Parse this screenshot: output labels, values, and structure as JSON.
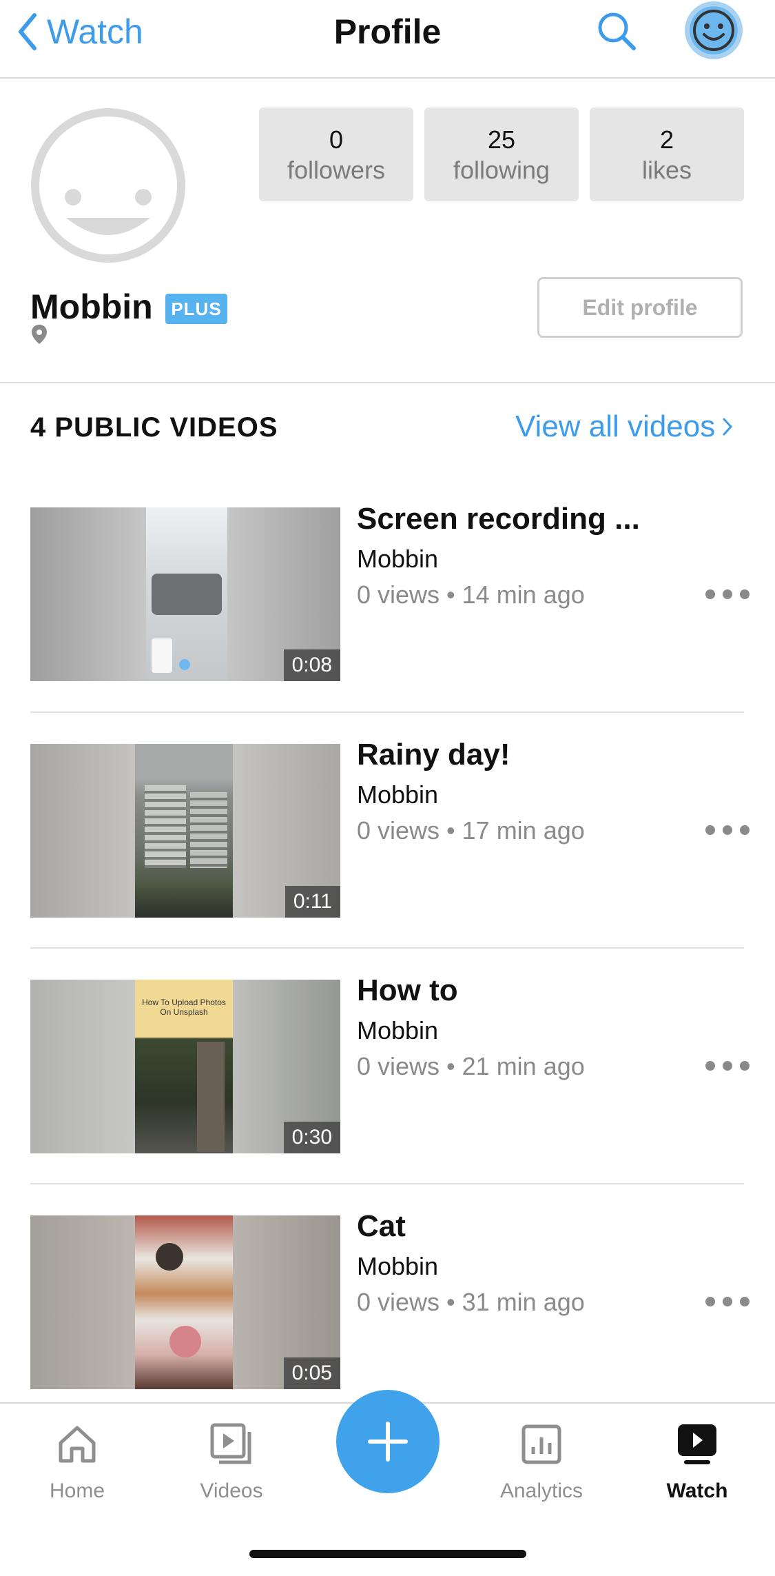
{
  "header": {
    "back_label": "Watch",
    "title": "Profile"
  },
  "profile": {
    "name": "Mobbin",
    "badge": "PLUS",
    "edit_label": "Edit profile",
    "stats": [
      {
        "value": "0",
        "label": "followers"
      },
      {
        "value": "25",
        "label": "following"
      },
      {
        "value": "2",
        "label": "likes"
      }
    ]
  },
  "videos_section": {
    "title": "4 PUBLIC VIDEOS",
    "view_all": "View all videos"
  },
  "videos": [
    {
      "title": "Screen recording ...",
      "author": "Mobbin",
      "meta": "0 views • 14 min ago",
      "duration": "0:08"
    },
    {
      "title": "Rainy day!",
      "author": "Mobbin",
      "meta": "0 views • 17 min ago",
      "duration": "0:11"
    },
    {
      "title": "How to",
      "author": "Mobbin",
      "meta": "0 views • 21 min ago",
      "duration": "0:30",
      "thumb_text": "How To Upload Photos On Unsplash"
    },
    {
      "title": "Cat",
      "author": "Mobbin",
      "meta": "0 views • 31 min ago",
      "duration": "0:05"
    }
  ],
  "tabbar": {
    "home": "Home",
    "videos": "Videos",
    "analytics": "Analytics",
    "watch": "Watch"
  },
  "colors": {
    "accent": "#3d9be9",
    "badge": "#57b2f0",
    "stat_bg": "#e5e5e5"
  }
}
